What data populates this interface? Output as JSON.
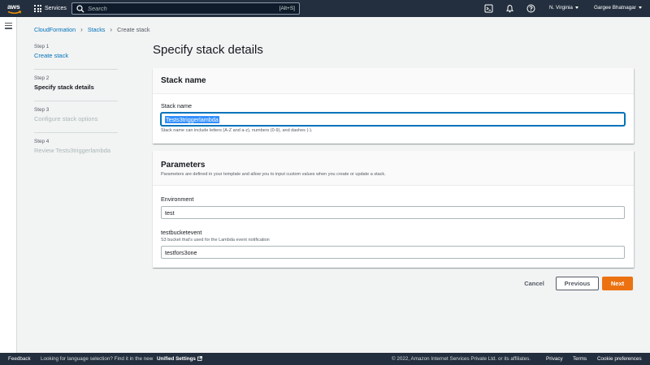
{
  "topnav": {
    "logo_text": "aws",
    "services_label": "Services",
    "search_placeholder": "Search",
    "search_shortcut": "[Alt+S]",
    "region_label": "N. Virginia",
    "user_label": "Gargee Bhatnagar"
  },
  "breadcrumb": {
    "items": [
      "CloudFormation",
      "Stacks",
      "Create stack"
    ]
  },
  "steps": [
    {
      "number": "Step 1",
      "label": "Create stack",
      "state": "link"
    },
    {
      "number": "Step 2",
      "label": "Specify stack details",
      "state": "current"
    },
    {
      "number": "Step 3",
      "label": "Configure stack options",
      "state": "disabled"
    },
    {
      "number": "Step 4",
      "label": "Review Tests3triggerlambda",
      "state": "disabled"
    }
  ],
  "page_title": "Specify stack details",
  "stack_name_panel": {
    "title": "Stack name",
    "field_label": "Stack name",
    "value": "Tests3triggerlambda",
    "hint": "Stack name can include letters (A-Z and a-z), numbers (0-9), and dashes (-)."
  },
  "parameters_panel": {
    "title": "Parameters",
    "description": "Parameters are defined in your template and allow you to input custom values when you create or update a stack.",
    "fields": [
      {
        "label": "Environment",
        "description": "",
        "value": "test"
      },
      {
        "label": "testbucketevent",
        "description": "S3 bucket that's used for the Lambda event notification",
        "value": "testfors3one"
      }
    ]
  },
  "actions": {
    "cancel": "Cancel",
    "previous": "Previous",
    "next": "Next"
  },
  "footer": {
    "feedback": "Feedback",
    "language_prompt": "Looking for language selection? Find it in the new",
    "unified_settings": "Unified Settings",
    "copyright": "© 2022, Amazon Internet Services Private Ltd. or its affiliates.",
    "privacy": "Privacy",
    "terms": "Terms",
    "cookie": "Cookie preferences"
  },
  "colors": {
    "nav_bg": "#232f3e",
    "link": "#0073bb",
    "primary_button": "#ec7211",
    "page_bg": "#f2f3f3"
  },
  "icons": [
    "aws-logo",
    "services-grid-icon",
    "search-icon",
    "cloudshell-icon",
    "bell-icon",
    "help-icon",
    "menu-icon",
    "external-link-icon"
  ]
}
